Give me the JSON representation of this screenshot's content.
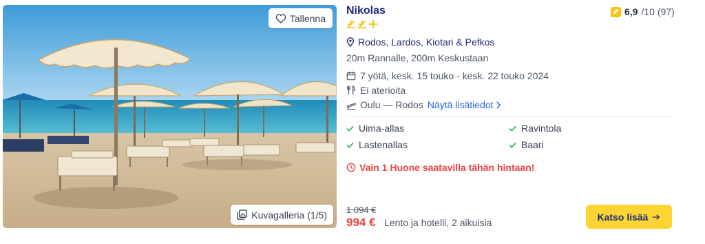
{
  "photo": {
    "save_label": "Tallenna",
    "gallery_label": "Kuvagalleria (1/5)"
  },
  "hotel": {
    "name": "Nikolas",
    "stars": 2.5,
    "rating_score": "6,9",
    "rating_scale": "/10 (97)",
    "location": "Rodos, Lardos, Kiotari & Pefkos",
    "distance": "20m Rannalle, 200m Keskustaan"
  },
  "details": {
    "dates": "7 yötä, kesk. 15 touko - kesk. 22 touko 2024",
    "meals": "Ei aterioita",
    "flight": "Oulu — Rodos",
    "more_link": "Näytä lisätiedot"
  },
  "amenities": [
    "Uima-allas",
    "Ravintola",
    "Lastenallas",
    "Baari"
  ],
  "availability": "Vain 1 Huone saatavilla tähän hintaan!",
  "pricing": {
    "old_price": "1 094 €",
    "price": "994 €",
    "note": "Lento ja hotelli, 2 aikuisia",
    "cta_label": "Katso lisää"
  },
  "colors": {
    "brand_navy": "#1e2a78",
    "accent_yellow": "#fcd535",
    "alert_red": "#ef4444",
    "link_blue": "#2563eb",
    "check_green": "#16a34a"
  }
}
